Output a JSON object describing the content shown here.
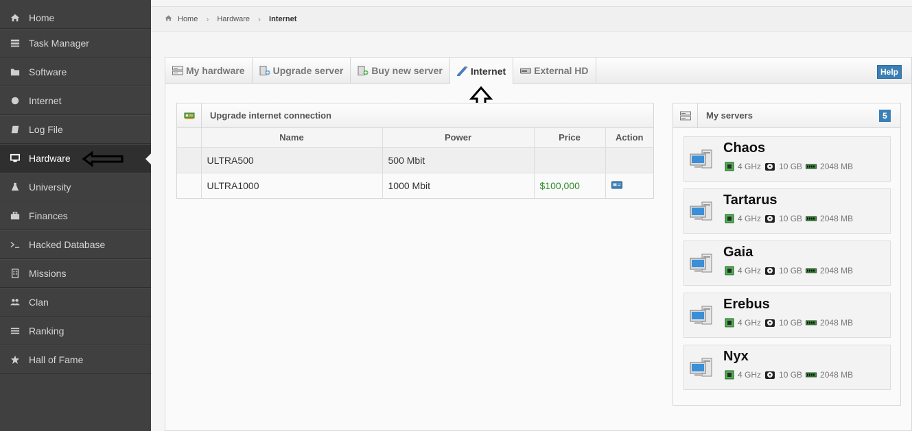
{
  "sidebar": {
    "items": [
      {
        "label": "Home",
        "icon": "home-icon"
      },
      {
        "label": "Task Manager",
        "icon": "tasks-icon"
      },
      {
        "label": "Software",
        "icon": "folder-icon"
      },
      {
        "label": "Internet",
        "icon": "globe-icon"
      },
      {
        "label": "Log File",
        "icon": "book-icon"
      },
      {
        "label": "Hardware",
        "icon": "desktop-icon"
      },
      {
        "label": "University",
        "icon": "flask-icon"
      },
      {
        "label": "Finances",
        "icon": "briefcase-icon"
      },
      {
        "label": "Hacked Database",
        "icon": "terminal-icon"
      },
      {
        "label": "Missions",
        "icon": "building-icon"
      },
      {
        "label": "Clan",
        "icon": "group-icon"
      },
      {
        "label": "Ranking",
        "icon": "list-icon"
      },
      {
        "label": "Hall of Fame",
        "icon": "star-icon"
      }
    ],
    "active": "Hardware"
  },
  "breadcrumb": {
    "items": [
      "Home",
      "Hardware",
      "Internet"
    ]
  },
  "tabs": {
    "items": [
      "My hardware",
      "Upgrade server",
      "Buy new server",
      "Internet",
      "External HD"
    ],
    "active": "Internet",
    "help_label": "Help"
  },
  "upgrade": {
    "title": "Upgrade internet connection",
    "columns": [
      "Name",
      "Power",
      "Price",
      "Action"
    ],
    "rows": [
      {
        "name": "ULTRA500",
        "power": "500 Mbit",
        "price": "",
        "action": false
      },
      {
        "name": "ULTRA1000",
        "power": "1000 Mbit",
        "price": "$100,000",
        "action": true
      }
    ]
  },
  "servers": {
    "title": "My servers",
    "count": "5",
    "items": [
      {
        "name": "Chaos",
        "cpu": "4 GHz",
        "hdd": "10 GB",
        "ram": "2048 MB"
      },
      {
        "name": "Tartarus",
        "cpu": "4 GHz",
        "hdd": "10 GB",
        "ram": "2048 MB"
      },
      {
        "name": "Gaia",
        "cpu": "4 GHz",
        "hdd": "10 GB",
        "ram": "2048 MB"
      },
      {
        "name": "Erebus",
        "cpu": "4 GHz",
        "hdd": "10 GB",
        "ram": "2048 MB"
      },
      {
        "name": "Nyx",
        "cpu": "4 GHz",
        "hdd": "10 GB",
        "ram": "2048 MB"
      }
    ]
  },
  "colors": {
    "sidebar_bg": "#404040",
    "accent": "#3b7fb5",
    "price_green": "#2a8a2a"
  }
}
